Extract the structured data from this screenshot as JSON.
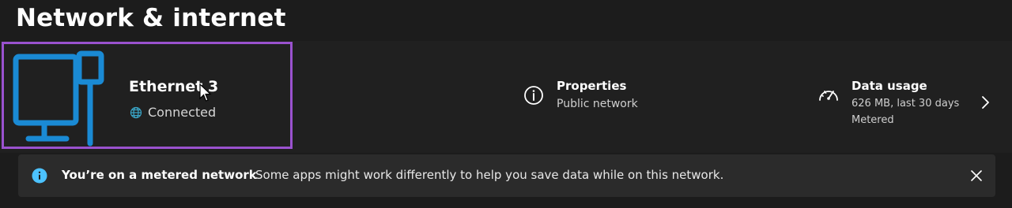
{
  "page": {
    "title": "Network & internet"
  },
  "connection": {
    "name": "Ethernet 3",
    "status": "Connected",
    "icon": "ethernet-computer-icon",
    "status_icon": "globe-icon",
    "accent_color": "#1a8ad4",
    "highlight_color": "#9a52cf"
  },
  "properties": {
    "title": "Properties",
    "subtitle": "Public network",
    "icon": "info-circle-icon"
  },
  "data_usage": {
    "title": "Data usage",
    "line1": "626 MB, last 30 days",
    "line2": "Metered",
    "icon": "gauge-icon",
    "chevron_icon": "chevron-right-icon"
  },
  "banner": {
    "title": "You’re on a metered network",
    "message": "Some apps might work differently to help you save data while on this network.",
    "icon": "info-icon",
    "close_icon": "close-icon",
    "icon_color": "#4cc2ff"
  }
}
